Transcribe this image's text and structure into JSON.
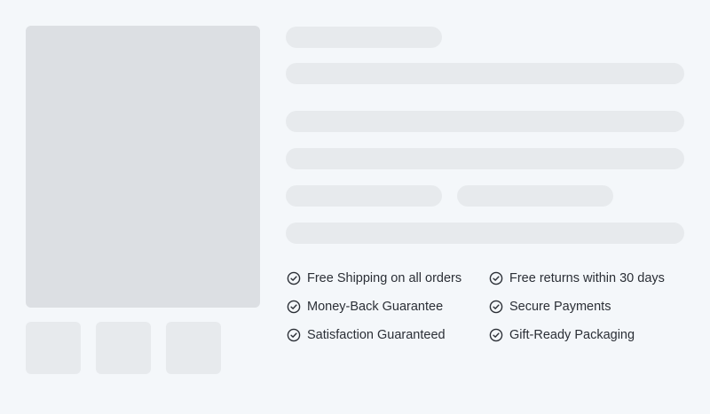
{
  "gallery": {
    "thumbnails": 3
  },
  "features": {
    "left": [
      {
        "label": "Free Shipping on all orders",
        "icon": "check-circle-icon"
      },
      {
        "label": "Money-Back Guarantee",
        "icon": "check-circle-icon"
      },
      {
        "label": "Satisfaction Guaranteed",
        "icon": "check-circle-icon"
      }
    ],
    "right": [
      {
        "label": "Free returns within 30 days",
        "icon": "check-circle-icon"
      },
      {
        "label": "Secure Payments",
        "icon": "check-circle-icon"
      },
      {
        "label": "Gift-Ready Packaging",
        "icon": "check-circle-icon"
      }
    ]
  },
  "colors": {
    "background": "#f4f7fa",
    "placeholder_main": "#dcdfe3",
    "placeholder_light": "#e7eaed",
    "text": "#2b2f36"
  }
}
